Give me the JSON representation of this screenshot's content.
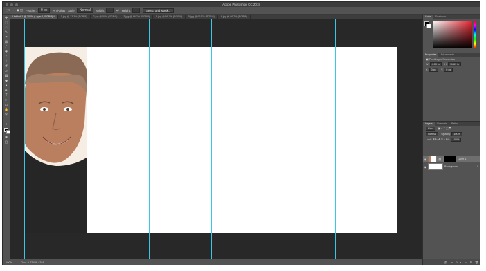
{
  "window": {
    "title": "Adobe Photoshop CC 2018"
  },
  "options_bar": {
    "feather_label": "Feather:",
    "feather_value": "0 px",
    "antialias_label": "Anti-alias",
    "style_label": "Style:",
    "style_value": "Normal",
    "width_label": "Width:",
    "height_label": "Height:",
    "select_mask_button": "Select and Mask..."
  },
  "tabs": [
    {
      "label": "Untitled-1 @ 100% (Layer 1, RGB/8) *"
    },
    {
      "label": "1.jpg @ 33.3% (RGB/8)"
    },
    {
      "label": "2.jpg @ 50% (RGB/8)"
    },
    {
      "label": "3.jpg @ 66.7% (RGB/8)"
    },
    {
      "label": "4.jpg @ 66.7% (RGB/8)"
    },
    {
      "label": "5.jpg @ 66.7% (RGB/8)"
    },
    {
      "label": "6.jpg @ 66.7% (RGB/8)"
    }
  ],
  "status": {
    "zoom": "100%",
    "doc": "Doc: 5.72M/9.43M"
  },
  "panels": {
    "color_tabs": [
      "Color",
      "Swatches"
    ],
    "properties_tabs": [
      "Properties",
      "Adjustments"
    ],
    "properties_title": "Pixel Layer Properties",
    "w_label": "W:",
    "w_value": "4.00 in",
    "h_label": "H:",
    "h_value": "11.69 in",
    "x_label": "X:",
    "x_value": "0 px",
    "y_label": "Y:",
    "y_value": "0 px",
    "layers_tabs": [
      "Layers",
      "Channels",
      "Paths"
    ],
    "kind_label": "Kind",
    "blend_mode": "Normal",
    "opacity_label": "Opacity:",
    "opacity_value": "100%",
    "lock_label": "Lock:",
    "fill_label": "Fill:",
    "fill_value": "100%",
    "layers": [
      {
        "name": "Layer 1"
      },
      {
        "name": "Background"
      }
    ]
  },
  "icons": {
    "eye": "eye-icon",
    "lock": "lock-icon",
    "link": "link-icon",
    "fx": "fx-icon",
    "mask": "mask-icon",
    "adjustment": "adjustment-layer-icon",
    "folder": "group-folder-icon",
    "new_layer": "new-layer-icon",
    "trash": "trash-icon"
  },
  "colors": {
    "guide": "#3cc6e6",
    "canvas": "#282828",
    "ui": "#535353"
  }
}
